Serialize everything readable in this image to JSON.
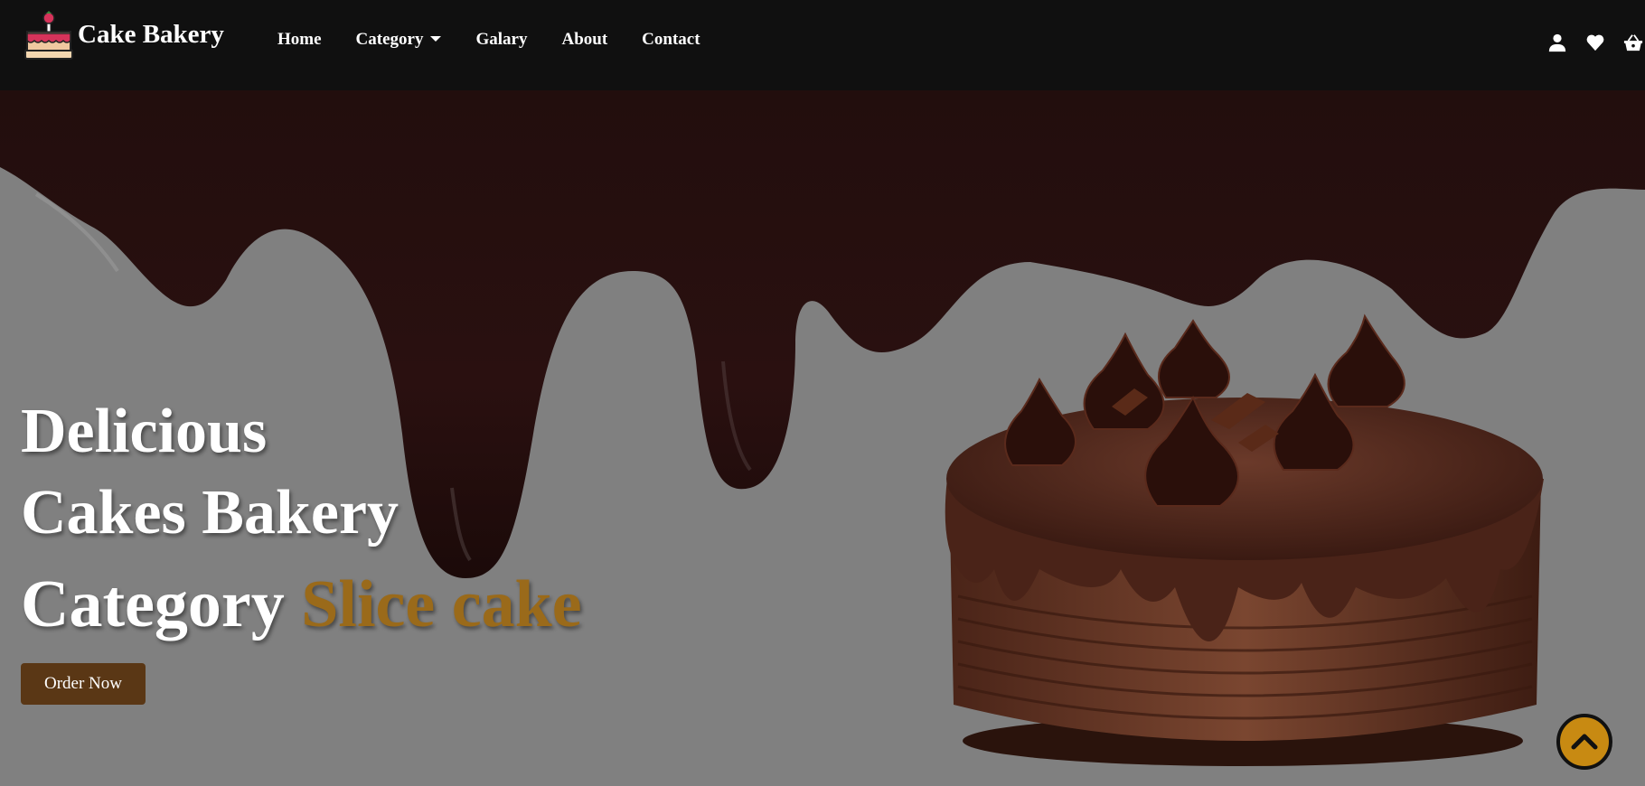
{
  "brand": {
    "name": "Cake Bakery",
    "logo_icon": "cake-logo-icon"
  },
  "nav": {
    "links": [
      "Home",
      "Category",
      "Galary",
      "About",
      "Contact"
    ],
    "icons": [
      "user-icon",
      "heart-icon",
      "basket-icon"
    ]
  },
  "hero": {
    "line1": "Delicious",
    "line2": "Cakes Bakery",
    "line3_prefix": "Category",
    "line3_accent": "Slice cake",
    "button_label": "Order Now"
  },
  "colors": {
    "navbar": "#101010",
    "background": "#808080",
    "chocolate": "#2a1010",
    "accent": "#9a6a1a",
    "button": "#5a3715",
    "scroll_top": "#c88a12"
  },
  "scroll_top_icon": "chevron-up-icon"
}
